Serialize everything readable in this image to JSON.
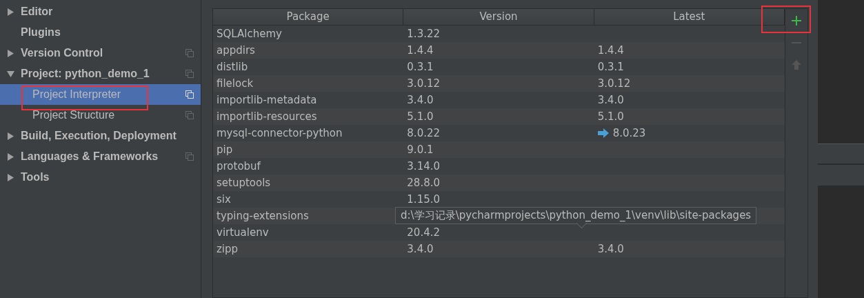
{
  "sidebar": {
    "items": [
      {
        "label": "Editor",
        "expanded": false,
        "shared": false,
        "selected": false
      },
      {
        "label": "Plugins",
        "shared": false,
        "selected": false
      },
      {
        "label": "Version Control",
        "expanded": false,
        "shared": true,
        "selected": false
      },
      {
        "label": "Project: python_demo_1",
        "expanded": true,
        "shared": true,
        "selected": false,
        "children": [
          {
            "label": "Project Interpreter",
            "shared": true,
            "selected": true,
            "annotated": true
          },
          {
            "label": "Project Structure",
            "shared": true,
            "selected": false
          }
        ]
      },
      {
        "label": "Build, Execution, Deployment",
        "expanded": false,
        "shared": false,
        "selected": false
      },
      {
        "label": "Languages & Frameworks",
        "expanded": false,
        "shared": true,
        "selected": false
      },
      {
        "label": "Tools",
        "expanded": false,
        "shared": false,
        "selected": false
      }
    ]
  },
  "table": {
    "columns": [
      "Package",
      "Version",
      "Latest"
    ],
    "rows": [
      {
        "package": "SQLAlchemy",
        "version": "1.3.22"
      },
      {
        "package": "appdirs",
        "version": "1.4.4",
        "latest": "1.4.4"
      },
      {
        "package": "distlib",
        "version": "0.3.1",
        "latest": "0.3.1"
      },
      {
        "package": "filelock",
        "version": "3.0.12",
        "latest": "3.0.12"
      },
      {
        "package": "importlib-metadata",
        "version": "3.4.0",
        "latest": "3.4.0"
      },
      {
        "package": "importlib-resources",
        "version": "5.1.0",
        "latest": "5.1.0"
      },
      {
        "package": "mysql-connector-python",
        "version": "8.0.22",
        "latest": "8.0.23",
        "upgrade": true
      },
      {
        "package": "pip",
        "version": "9.0.1"
      },
      {
        "package": "protobuf",
        "version": "3.14.0"
      },
      {
        "package": "setuptools",
        "version": "28.8.0"
      },
      {
        "package": "six",
        "version": "1.15.0"
      },
      {
        "package": "typing-extensions"
      },
      {
        "package": "virtualenv",
        "version": "20.4.2"
      },
      {
        "package": "zipp",
        "version": "3.4.0",
        "latest": "3.4.0"
      }
    ]
  },
  "toolbar": {
    "add_annotated": true,
    "remove_disabled": true,
    "upgrade_disabled": true
  },
  "tooltip": {
    "text": "d:\\学习记录\\pycharmprojects\\python_demo_1\\venv\\lib\\site-packages"
  }
}
